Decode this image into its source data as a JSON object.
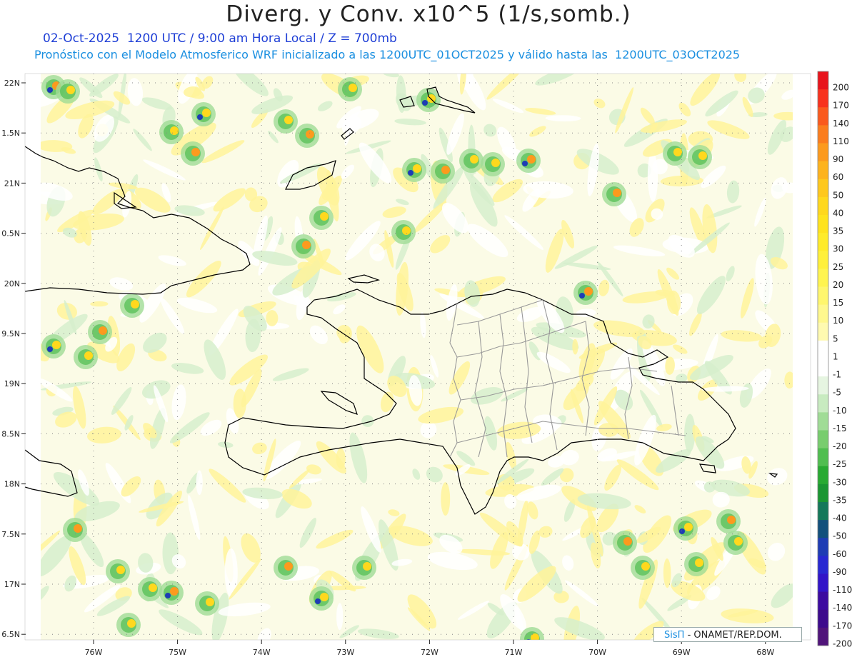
{
  "title": "Diverg. y Conv. x10^5 (1/s,somb.)",
  "subtitle_line1": "02-Oct-2025  1200 UTC / 9:00 am Hora Local / Z = 700mb",
  "subtitle_line2": "Pronóstico con el Modelo Atmosferico WRF inicializado a las 1200UTC_01OCT2025 y válido hasta las  1200UTC_03OCT2025",
  "lat_labels": [
    "22N",
    "1.5N",
    "21N",
    "0.5N",
    "20N",
    "9.5N",
    "19N",
    "8.5N",
    "18N",
    "7.5N",
    "17N",
    "6.5N"
  ],
  "lon_labels": [
    "76W",
    "75W",
    "74W",
    "73W",
    "72W",
    "71W",
    "70W",
    "69W",
    "68W"
  ],
  "colorbar": {
    "labels": [
      "200",
      "170",
      "140",
      "110",
      "90",
      "60",
      "50",
      "40",
      "35",
      "30",
      "25",
      "20",
      "15",
      "10",
      "5",
      "1",
      "-1",
      "-5",
      "-10",
      "-15",
      "-20",
      "-25",
      "-30",
      "-35",
      "-40",
      "-50",
      "-60",
      "-90",
      "-110",
      "-140",
      "-170",
      "-200"
    ],
    "colors": [
      "#e8141c",
      "#f8321e",
      "#fa5a1e",
      "#fb7d1e",
      "#fc9a1e",
      "#fdb31e",
      "#fec81e",
      "#ffd81e",
      "#ffe31e",
      "#ffeb2a",
      "#fff03a",
      "#fff450",
      "#fff66e",
      "#fff88e",
      "#fffab0",
      "#ffffff",
      "#ffffff",
      "#e6f5e1",
      "#c8ebc0",
      "#a0dc96",
      "#78cd6e",
      "#50be50",
      "#28aa32",
      "#1a9632",
      "#14785a",
      "#12507c",
      "#1e3cb4",
      "#2828d2",
      "#3214c8",
      "#3c0aa0",
      "#3c0a8c",
      "#50147a"
    ]
  },
  "credit": {
    "logo": "SisΠ",
    "text": "- ONAMET/REP.DOM."
  }
}
